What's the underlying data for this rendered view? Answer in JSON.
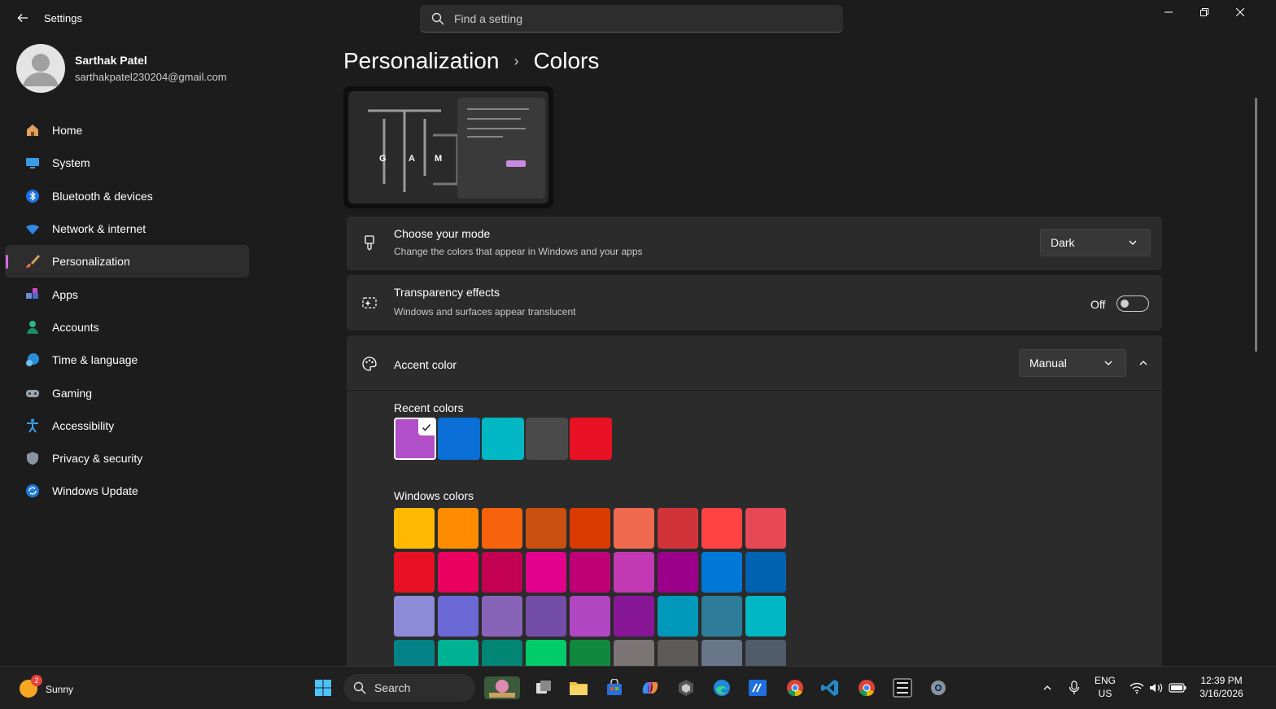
{
  "window": {
    "app_title": "Settings",
    "search_placeholder": "Find a setting",
    "controls": [
      "minimize",
      "maximize",
      "close"
    ]
  },
  "user": {
    "name": "Sarthak Patel",
    "email": "sarthakpatel230204@gmail.com"
  },
  "nav": {
    "items": [
      {
        "label": "Home",
        "icon": "home-icon"
      },
      {
        "label": "System",
        "icon": "system-icon"
      },
      {
        "label": "Bluetooth & devices",
        "icon": "bluetooth-icon"
      },
      {
        "label": "Network & internet",
        "icon": "wifi-icon"
      },
      {
        "label": "Personalization",
        "icon": "brush-icon",
        "active": true
      },
      {
        "label": "Apps",
        "icon": "apps-icon"
      },
      {
        "label": "Accounts",
        "icon": "accounts-icon"
      },
      {
        "label": "Time & language",
        "icon": "globe-clock-icon"
      },
      {
        "label": "Gaming",
        "icon": "gamepad-icon"
      },
      {
        "label": "Accessibility",
        "icon": "accessibility-icon"
      },
      {
        "label": "Privacy & security",
        "icon": "shield-icon"
      },
      {
        "label": "Windows Update",
        "icon": "update-icon"
      }
    ]
  },
  "breadcrumb": {
    "parent": "Personalization",
    "current": "Colors"
  },
  "preview": {
    "letters": [
      "G",
      "A",
      "M"
    ]
  },
  "settings": {
    "mode": {
      "title": "Choose your mode",
      "description": "Change the colors that appear in Windows and your apps",
      "value": "Dark"
    },
    "transparency": {
      "title": "Transparency effects",
      "description": "Windows and surfaces appear translucent",
      "state_label": "Off",
      "on": false
    },
    "accent": {
      "title": "Accent color",
      "value": "Manual"
    }
  },
  "recent_colors": {
    "label": "Recent colors",
    "colors": [
      "#b04fc8",
      "#0a6fd6",
      "#00b7c3",
      "#4a4a4a",
      "#e81123"
    ],
    "selected_index": 0
  },
  "windows_colors": {
    "label": "Windows colors",
    "rows": [
      [
        "#ffb900",
        "#ff8c00",
        "#f7630c",
        "#ca5010",
        "#da3b01",
        "#ef6950",
        "#d13438",
        "#ff4343",
        "#e74856"
      ],
      [
        "#e81123",
        "#ea005e",
        "#c30052",
        "#e3008c",
        "#bf0077",
        "#c239b3",
        "#9a0089",
        "#0078d7",
        "#0063b1"
      ],
      [
        "#8e8cd8",
        "#6b69d6",
        "#8764b8",
        "#744da9",
        "#b146c2",
        "#881798",
        "#0099bc",
        "#2d7d9a",
        "#00b7c3"
      ],
      [
        "#038387",
        "#00b294",
        "#018574",
        "#00cc6a",
        "#10893e",
        "#7a7574",
        "#5d5a58",
        "#68768a",
        "#515c6b"
      ]
    ]
  },
  "taskbar": {
    "weather": {
      "label": "Sunny",
      "badge": "2"
    },
    "search_label": "Search",
    "language": {
      "line1": "ENG",
      "line2": "US"
    },
    "clock": {
      "time": "12:39 PM",
      "date": "3/16/2026"
    }
  }
}
